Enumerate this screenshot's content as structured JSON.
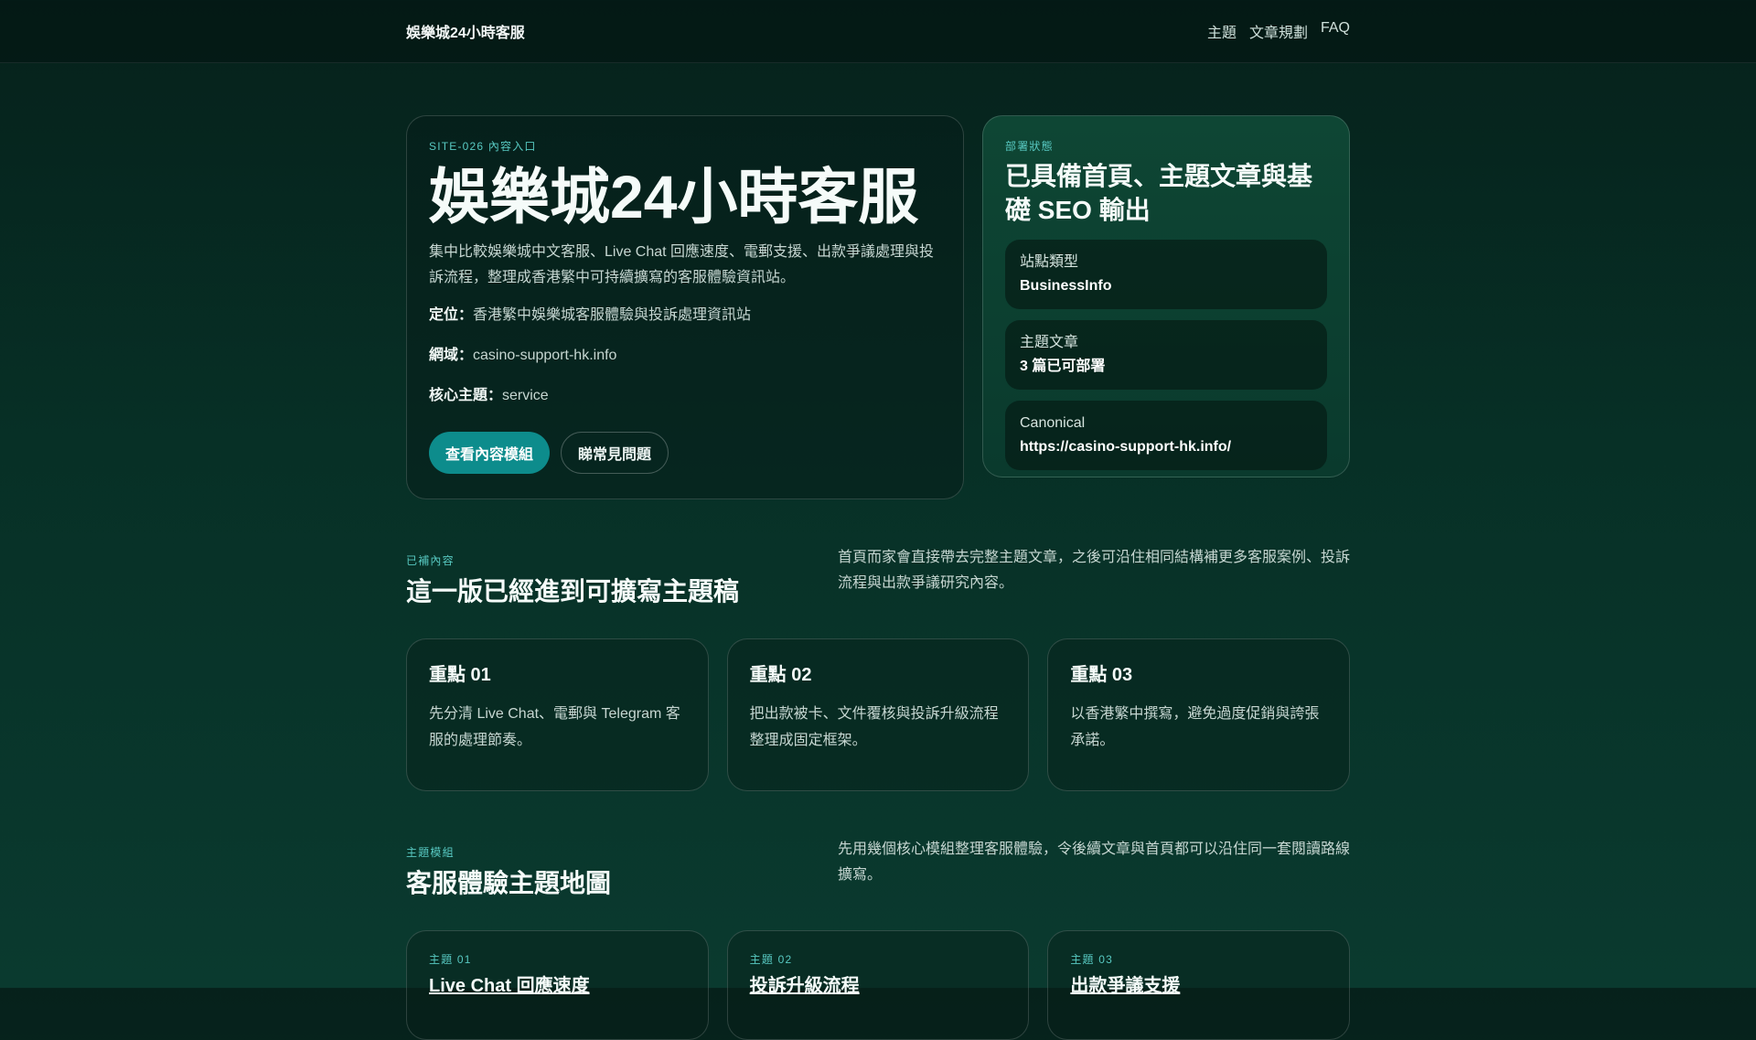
{
  "header": {
    "brand": "娛樂城24小時客服",
    "nav": [
      "主題",
      "文章規劃",
      "FAQ"
    ]
  },
  "hero": {
    "eyebrow": "SITE-026 內容入口",
    "title": "娛樂城24小時客服",
    "description": "集中比較娛樂城中文客服、Live Chat 回應速度、電郵支援、出款爭議處理與投訴流程，整理成香港繁中可持續擴寫的客服體驗資訊站。",
    "positioning_label": "定位：",
    "positioning_value": "香港繁中娛樂城客服體驗與投訴處理資訊站",
    "domain_label": "網域：",
    "domain_value": "casino-support-hk.info",
    "topic_label": "核心主題：",
    "topic_value": "service",
    "primary_button": "查看內容模組",
    "secondary_button": "睇常見問題"
  },
  "status": {
    "eyebrow": "部署狀態",
    "title": "已具備首頁、主題文章與基礎 SEO 輸出",
    "items": [
      {
        "label": "站點類型",
        "value": "BusinessInfo"
      },
      {
        "label": "主題文章",
        "value": "3 篇已可部署"
      },
      {
        "label": "Canonical",
        "value": "https://casino-support-hk.info/"
      }
    ]
  },
  "section1": {
    "eyebrow": "已補內容",
    "title": "這一版已經進到可擴寫主題稿",
    "note": "首頁而家會直接帶去完整主題文章，之後可沿住相同結構補更多客服案例、投訴流程與出款爭議研究內容。",
    "cards": [
      {
        "title": "重點 01",
        "desc": "先分清 Live Chat、電郵與 Telegram 客服的處理節奏。"
      },
      {
        "title": "重點 02",
        "desc": "把出款被卡、文件覆核與投訴升級流程整理成固定框架。"
      },
      {
        "title": "重點 03",
        "desc": "以香港繁中撰寫，避免過度促銷與誇張承諾。"
      }
    ]
  },
  "section2": {
    "eyebrow": "主題模組",
    "title": "客服體驗主題地圖",
    "note": "先用幾個核心模組整理客服體驗，令後續文章與首頁都可以沿住同一套閱讀路線擴寫。",
    "cards": [
      {
        "eyebrow": "主題 01",
        "title": "Live Chat 回應速度"
      },
      {
        "eyebrow": "主題 02",
        "title": "投訴升級流程"
      },
      {
        "eyebrow": "主題 03",
        "title": "出款爭議支援"
      }
    ]
  },
  "colors": {
    "background": "#073026",
    "accent": "#0d8c8c",
    "eyebrow": "#58c9c2"
  }
}
